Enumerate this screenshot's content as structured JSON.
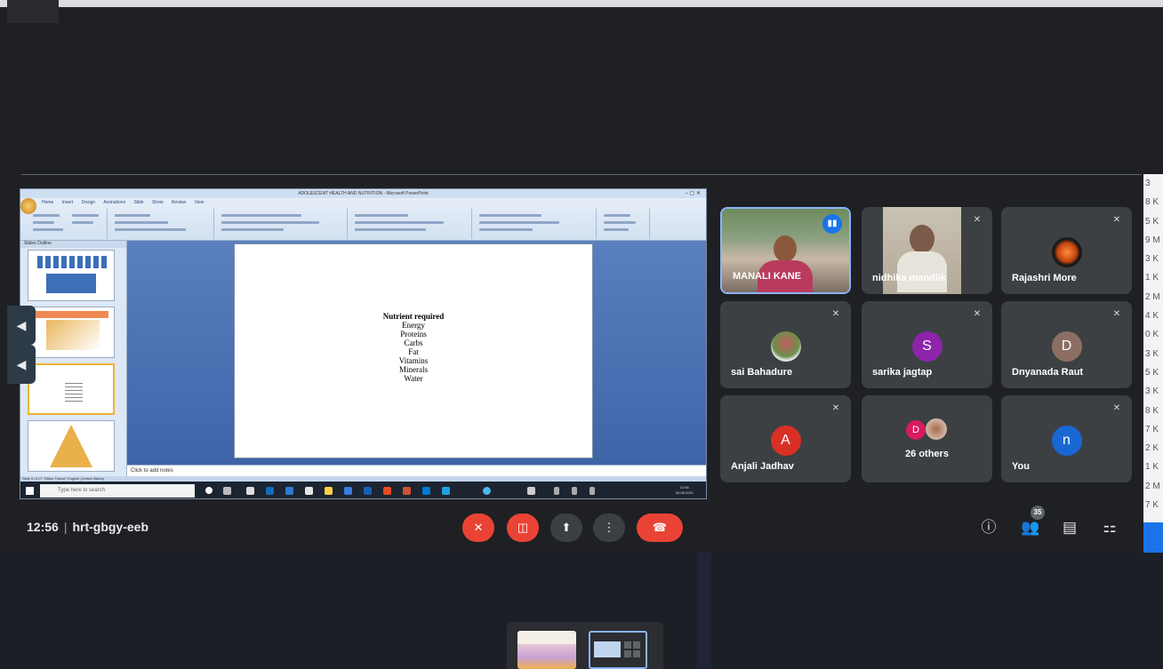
{
  "presentation": {
    "window_title": "ADOLESCENT HEALTH AND NUTRITION - Microsoft PowerPoint",
    "ribbon_tabs": [
      "Home",
      "Insert",
      "Design",
      "Animations",
      "Slide Show",
      "Review",
      "View"
    ],
    "side_tabs": "Slides   Outline",
    "slide": {
      "heading": "Nutrient required",
      "items": [
        "Energy",
        "Proteins",
        "Carbs",
        "Fat",
        "Vitamins",
        "Minerals",
        "Water"
      ]
    },
    "notes_placeholder": "Click to add notes",
    "status_bar": "Slide 5 of 17   \"Office Theme\"   English (United States)",
    "taskbar_search": "Type here to search",
    "clock_time": "12:56",
    "clock_date": "30-08-2021"
  },
  "participants": [
    {
      "name": "MANALI KANE",
      "speaking": true
    },
    {
      "name": "nidhika mandlik",
      "muted": true
    },
    {
      "name": "Rajashri More",
      "muted": true
    },
    {
      "name": "sai Bahadure",
      "muted": true
    },
    {
      "name": "sarika jagtap",
      "initial": "S",
      "muted": true
    },
    {
      "name": "Dnyanada Raut",
      "initial": "D",
      "muted": true
    },
    {
      "name": "Anjali Jadhav",
      "initial": "A",
      "muted": true
    },
    {
      "name": "26 others",
      "initial": "D"
    },
    {
      "name": "You",
      "initial": "n",
      "muted": true
    }
  ],
  "meeting": {
    "time": "12:56",
    "code": "hrt-gbgy-eeb",
    "participant_count": "35"
  },
  "right_list": [
    "3",
    "8 K",
    "5 K",
    "9 M",
    "3 K",
    "1 K",
    "2 M",
    "4 K",
    "0 K",
    "3 K",
    "5 K",
    "3 K",
    "8 K",
    "7 K",
    "2 K",
    "1 K",
    "2 M",
    "7 K"
  ],
  "colors": {
    "background": "#202124",
    "tile": "#3c4043",
    "red": "#ea4335",
    "accent": "#1a73e8",
    "avatar_s": "#8e24aa",
    "avatar_d": "#8d6e63",
    "avatar_a": "#d93025",
    "avatar_n": "#1967d2"
  },
  "icons": {
    "mic_off": "mic-off-icon",
    "camera_off": "camera-off-icon",
    "present": "present-icon",
    "more": "more-options-icon",
    "hangup": "hangup-icon",
    "info": "info-icon",
    "people": "people-icon",
    "chat": "chat-icon",
    "activities": "activities-icon"
  }
}
